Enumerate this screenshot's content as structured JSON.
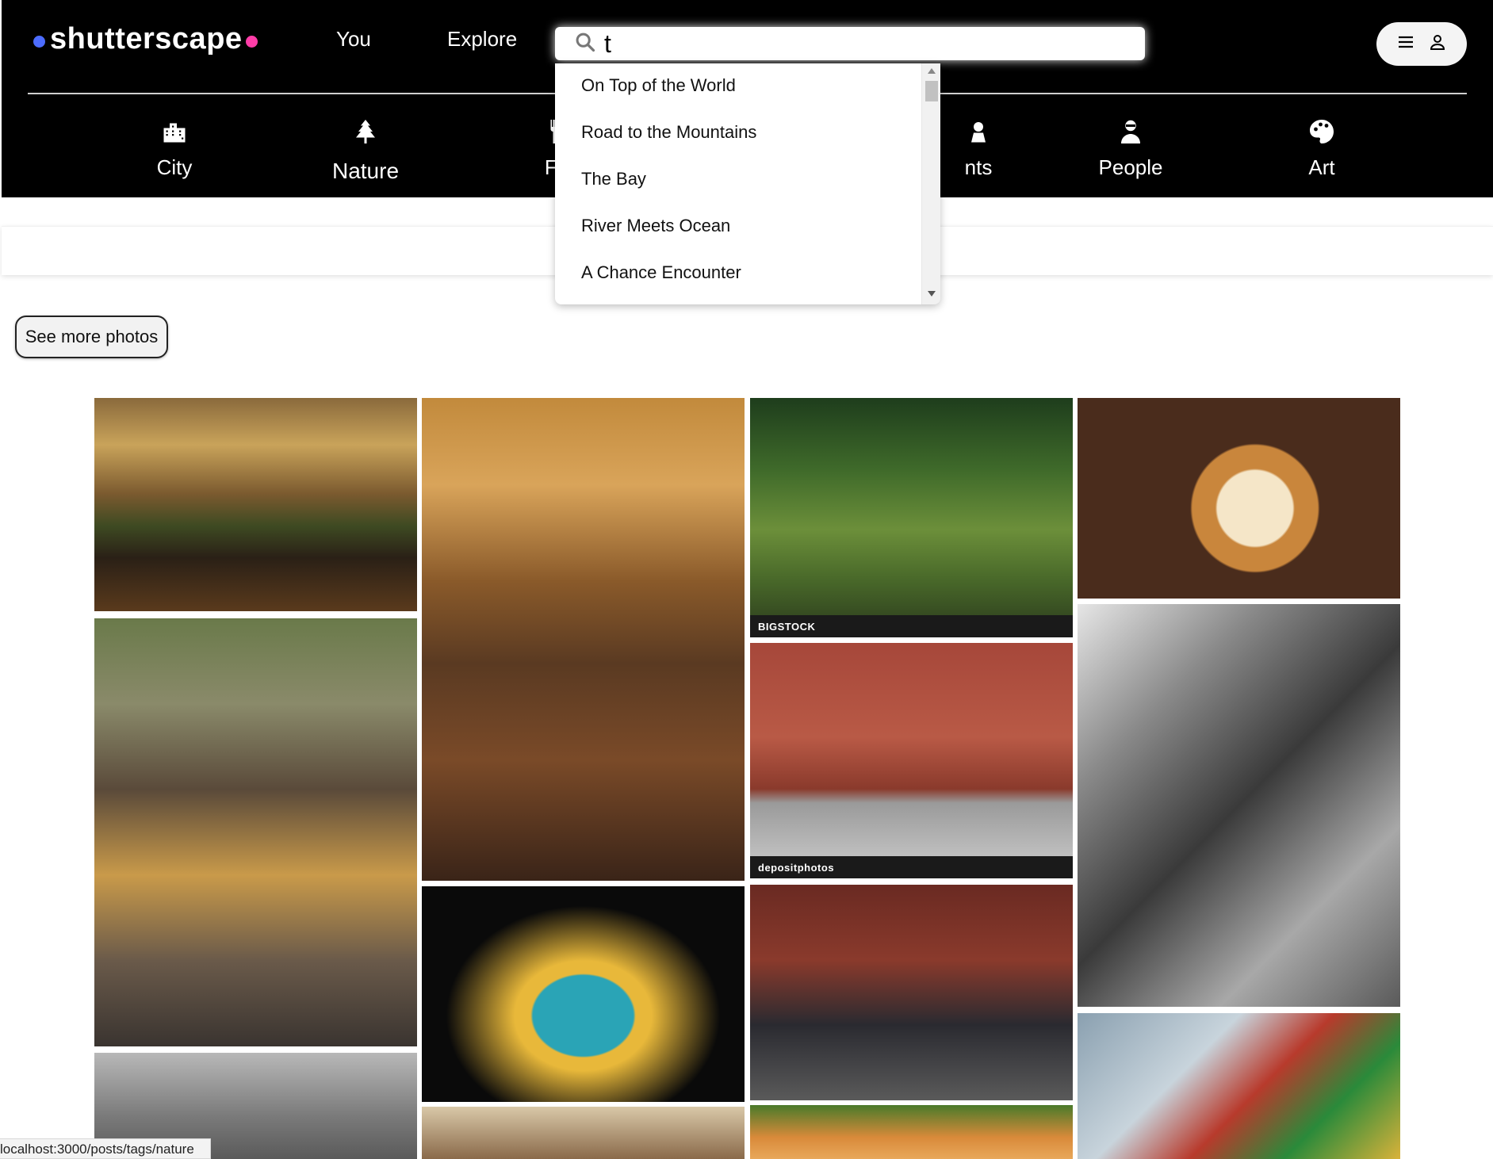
{
  "brand": {
    "name": "shutterscape",
    "blue": "#4c6cff",
    "pink": "#ff3da8"
  },
  "nav": {
    "you": "You",
    "explore": "Explore"
  },
  "search": {
    "value": "t",
    "icon": "search-icon"
  },
  "suggestions": [
    "On Top of the World",
    "Road to the Mountains",
    "The Bay",
    "River Meets Ocean",
    "A Chance Encounter"
  ],
  "categories": [
    {
      "label": "City",
      "icon": "city-icon"
    },
    {
      "label": "Nature",
      "icon": "tree-icon",
      "active": true
    },
    {
      "label": "Fo",
      "icon": "utensils-icon"
    },
    {
      "label": "nts",
      "icon": "event-icon"
    },
    {
      "label": "People",
      "icon": "person-icon"
    },
    {
      "label": "Art",
      "icon": "palette-icon"
    }
  ],
  "see_more": "See more photos",
  "watermarks": {
    "bigstock": "BIGSTOCK",
    "depositphotos": "depositphotos"
  },
  "status_url": "localhost:3000/posts/tags/nature",
  "user_menu": {
    "icons": [
      "menu-icon",
      "user-icon"
    ]
  }
}
